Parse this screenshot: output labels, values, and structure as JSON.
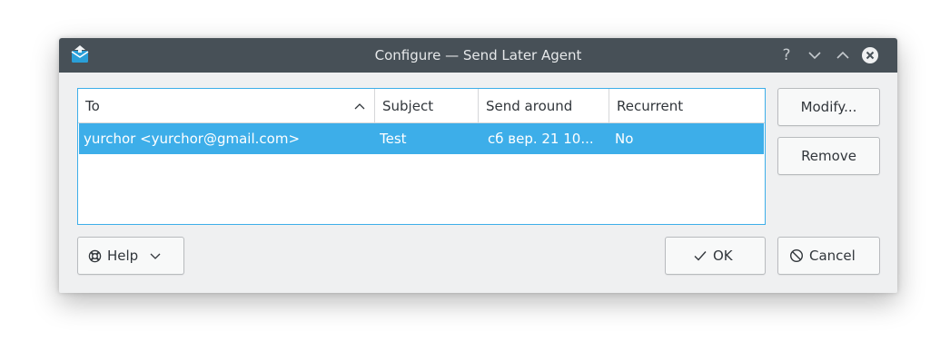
{
  "window": {
    "title": "Configure — Send Later Agent",
    "help_glyph": "?",
    "icons": {
      "app": "mail-send-icon",
      "help": "help-icon",
      "minimize": "chevron-down-icon",
      "maximize": "chevron-up-icon",
      "close": "close-icon"
    }
  },
  "table": {
    "columns": [
      "To",
      "Subject",
      "Send around",
      "Recurrent"
    ],
    "sort_column": "To",
    "sort_indicator": "sort-ascending-icon",
    "rows": [
      {
        "to": "yurchor <yurchor@gmail.com>",
        "subject": "Test",
        "send_around": "сб вер. 21 10...",
        "recurrent": "No",
        "selected": true
      }
    ]
  },
  "buttons": {
    "modify": "Modify...",
    "remove": "Remove",
    "help": "Help",
    "ok": "OK",
    "cancel": "Cancel"
  },
  "colors": {
    "titlebar": "#475057",
    "window_bg": "#eff0f1",
    "selection": "#3daee9",
    "text": "#31363b"
  }
}
